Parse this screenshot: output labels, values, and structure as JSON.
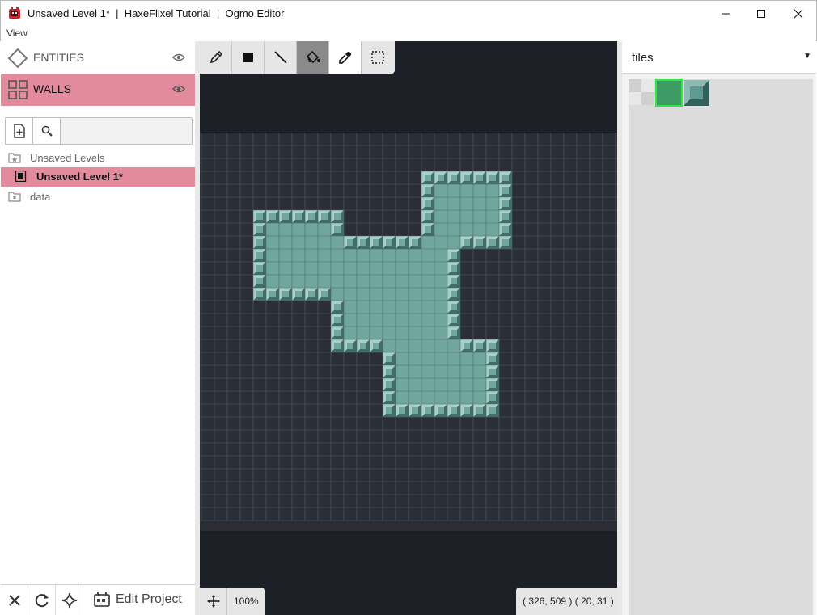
{
  "window": {
    "title": "Unsaved Level 1*  |  HaxeFlixel Tutorial  |  Ogmo Editor",
    "icon": "ogmo-app-icon"
  },
  "menu": {
    "items": [
      "View"
    ]
  },
  "layers": [
    {
      "label": "ENTITIES",
      "icon": "diamond-icon",
      "active": false
    },
    {
      "label": "WALLS",
      "icon": "grid-icon",
      "active": true
    }
  ],
  "level_tree": [
    {
      "label": "Unsaved Levels",
      "icon": "folder-star-icon",
      "selected": false
    },
    {
      "label": "Unsaved Level 1*",
      "icon": "level-file-icon",
      "selected": true
    },
    {
      "label": "data",
      "icon": "folder-icon",
      "selected": false
    }
  ],
  "left_footer": {
    "edit_project": "Edit Project"
  },
  "tools": [
    "pencil-icon",
    "rectangle-fill-icon",
    "line-icon",
    "flood-fill-icon",
    "eyedropper-icon",
    "select-icon"
  ],
  "status": {
    "zoom": "100%",
    "coords": "( 326, 509 ) ( 20, 31 )"
  },
  "tileset": {
    "name": "tiles"
  },
  "level": {
    "grid_cols": 32,
    "grid_rows": 30,
    "colors": {
      "background": "#1d2027",
      "grid_line": "#5a5f6b",
      "tile_fill": "#6fa79c",
      "tile_dark": "#3e6e67",
      "tile_light": "#a7d1c8",
      "accent_selected": "#2ee84a"
    }
  }
}
